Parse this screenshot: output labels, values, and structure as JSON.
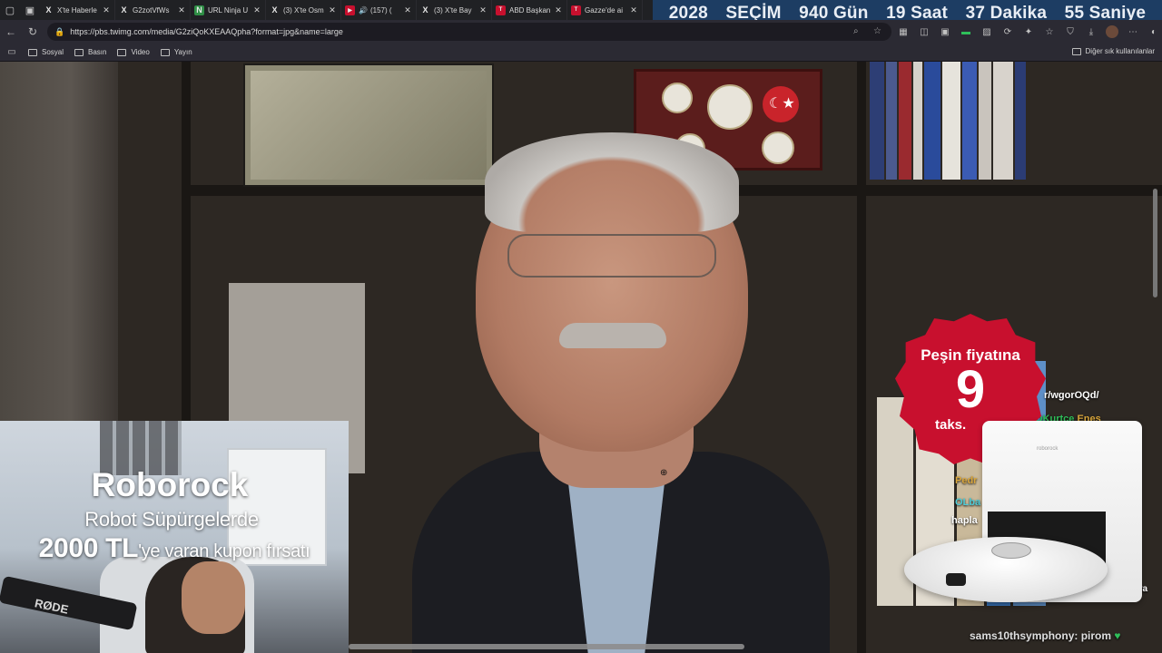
{
  "tabs": [
    {
      "title": "X'te Haberle",
      "fav": "X",
      "fav_type": "x"
    },
    {
      "title": "G2zotVfWs",
      "fav": "X",
      "fav_type": "x"
    },
    {
      "title": "URL Ninja U",
      "fav": "N",
      "fav_type": "green"
    },
    {
      "title": "(3) X'te Osm",
      "fav": "X",
      "fav_type": "x"
    },
    {
      "title": "(157) (",
      "fav": "▶",
      "fav_type": "red",
      "speaker": "🔊"
    },
    {
      "title": "(3) X'te Bay",
      "fav": "X",
      "fav_type": "x"
    },
    {
      "title": "ABD Başkan",
      "fav": "T",
      "fav_type": "red"
    },
    {
      "title": "Gazze'de ai",
      "fav": "T",
      "fav_type": "red"
    }
  ],
  "countdown": {
    "year": "2028",
    "label": "SEÇİM",
    "days": "940 Gün",
    "hours": "19 Saat",
    "minutes": "37 Dakika",
    "seconds": "55 Saniye"
  },
  "address": {
    "url": "https://pbs.twimg.com/media/G2ziQoKXEAAQpha?format=jpg&name=large"
  },
  "bookmarks": {
    "items": [
      "Sosyal",
      "Basın",
      "Video",
      "Yayın"
    ],
    "other": "Diğer sık kullanılanlar"
  },
  "ad_left": {
    "brand": "Roborock",
    "line1": "Robot Süpürgelerde",
    "amount": "2000 TL",
    "suffix": "'ye varan kupon fırsatı"
  },
  "ad_right": {
    "badge_line1": "Peşin fiyatına",
    "badge_number": "9",
    "badge_line3": "taks.",
    "brand_small": "roborock"
  },
  "webcam": {
    "mic_label": "RØDE"
  },
  "chat": {
    "url_frag": "r/wgorOQd/",
    "name1": "OKurtce",
    "name1b": "Enes",
    "name2": "Pedr",
    "name3": "OLba",
    "text3": "hapla",
    "tail": "va",
    "bottom_user": "sams10thsymphony:",
    "bottom_msg": "pirom",
    "bottom_emoji": "♥"
  },
  "colors": {
    "countdown_bg": "#1d3d63",
    "badge_red": "#c8102e",
    "tab_bg": "#202124",
    "toolbar_bg": "#2b2a33"
  }
}
